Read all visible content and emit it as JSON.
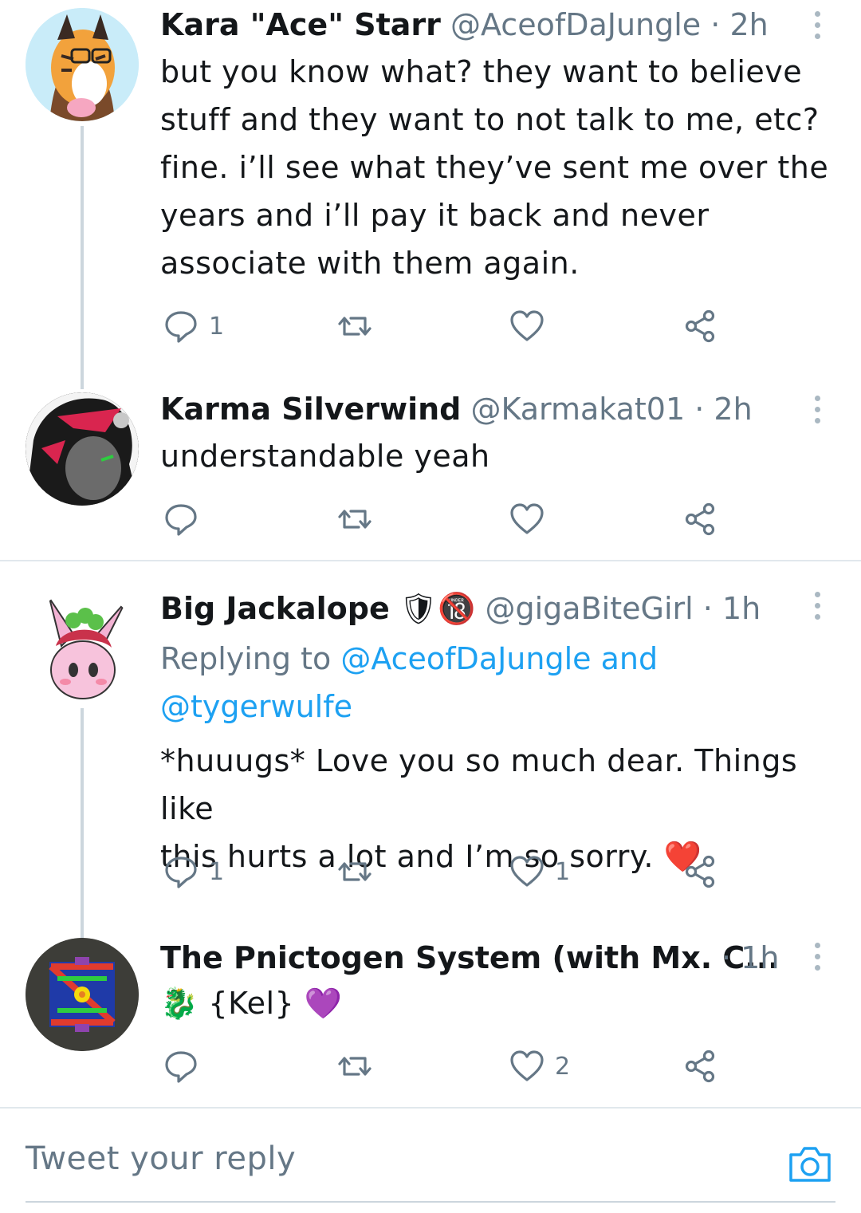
{
  "tweets": [
    {
      "name": "Kara \"Ace\" Starr",
      "handle": "@AceofDaJungle",
      "time": "· 2h",
      "lines": [
        "but you know what? they want to believe",
        "stuff and they want to not talk to me, etc?",
        "fine. i’ll see what they’ve sent me over the",
        "years and i’ll pay it back and never",
        "associate with them again."
      ],
      "reply_count": "1",
      "like_count": ""
    },
    {
      "name": "Karma Silverwind",
      "handle": "@Karmakat01",
      "time": "· 2h",
      "lines": [
        "understandable yeah"
      ],
      "reply_count": "",
      "like_count": ""
    },
    {
      "name": "Big Jackalope",
      "name_emoji": "🛡🔞",
      "handle": "@gigaBiteGirl",
      "time": "· 1h",
      "replying_prefix": "Replying to",
      "replying_link1": "@AceofDaJungle and",
      "replying_link2": "@tygerwulfe",
      "lines": [
        "*huuugs* Love you so much dear. Things like",
        "this hurts a lot and I’m so sorry. ❤️"
      ],
      "reply_count": "1",
      "like_count": "1"
    },
    {
      "name": "The Pnictogen System (with Mx. C...",
      "handle": "",
      "time": "· 1h",
      "lines": [
        "🐉 {Kel} 💜"
      ],
      "reply_count": "",
      "like_count": "2"
    }
  ],
  "reply_bar": {
    "placeholder": "Tweet your reply"
  },
  "icons": {
    "reply": "reply-icon",
    "retweet": "retweet-icon",
    "like": "heart-icon",
    "share": "share-icon",
    "camera": "camera-icon",
    "menu": "more-vertical-icon"
  },
  "colors": {
    "link": "#1da1f2",
    "secondary": "#657786",
    "divider": "#e1e8ed"
  }
}
